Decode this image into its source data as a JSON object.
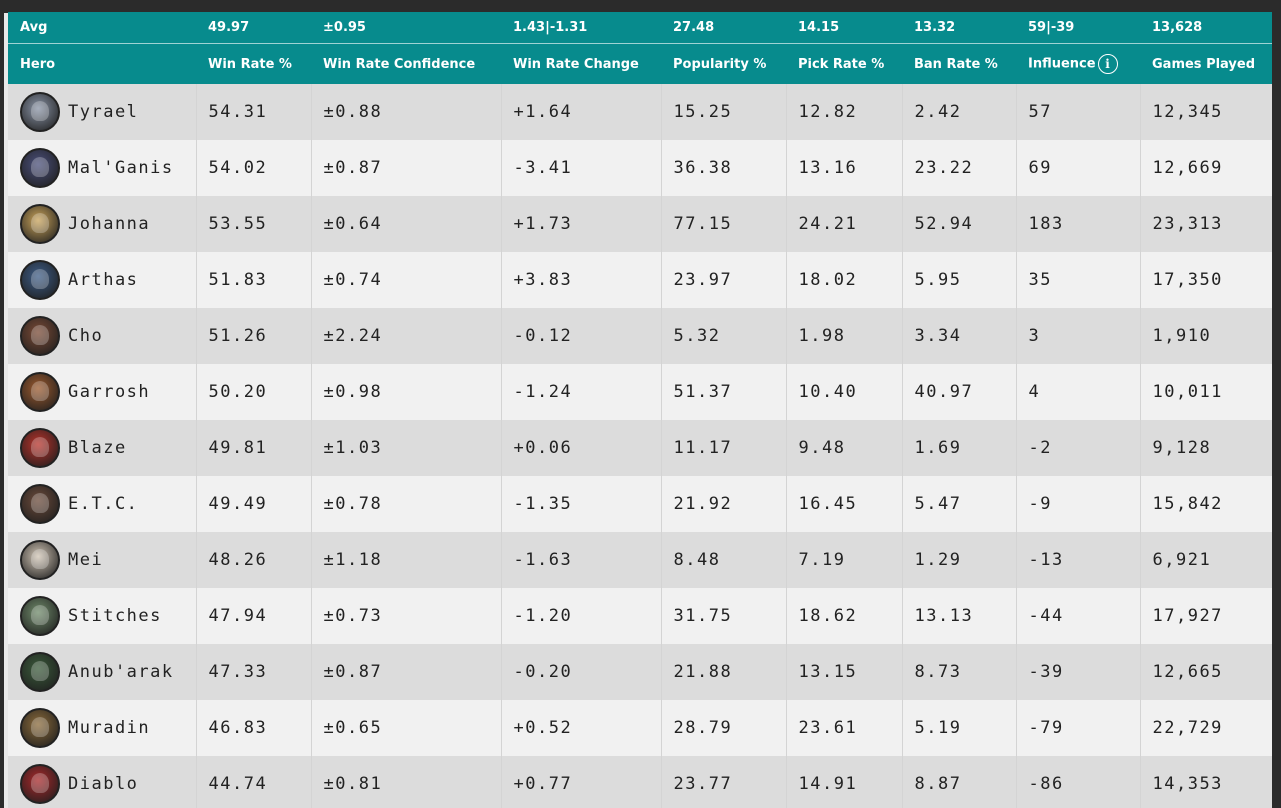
{
  "columns": [
    "Hero",
    "Win Rate %",
    "Win Rate Confidence",
    "Win Rate Change",
    "Popularity %",
    "Pick Rate %",
    "Ban Rate %",
    "Influence",
    "Games Played"
  ],
  "avg": [
    "Avg",
    "49.97",
    "±0.95",
    "1.43|-1.31",
    "27.48",
    "14.15",
    "13.32",
    "59|-39",
    "13,628"
  ],
  "info_icon": "i",
  "rows": [
    {
      "hero": "Tyrael",
      "avatar_color": "#8a94a6",
      "cells": [
        "54.31",
        "±0.88",
        "+1.64",
        "15.25",
        "12.82",
        "2.42",
        "57",
        "12,345"
      ]
    },
    {
      "hero": "Mal'Ganis",
      "avatar_color": "#4a4f7a",
      "cells": [
        "54.02",
        "±0.87",
        "-3.41",
        "36.38",
        "13.16",
        "23.22",
        "69",
        "12,669"
      ]
    },
    {
      "hero": "Johanna",
      "avatar_color": "#c9a35a",
      "cells": [
        "53.55",
        "±0.64",
        "+1.73",
        "77.15",
        "24.21",
        "52.94",
        "183",
        "23,313"
      ]
    },
    {
      "hero": "Arthas",
      "avatar_color": "#3d5c86",
      "cells": [
        "51.83",
        "±0.74",
        "+3.83",
        "23.97",
        "18.02",
        "5.95",
        "35",
        "17,350"
      ]
    },
    {
      "hero": "Cho",
      "avatar_color": "#7a4a35",
      "cells": [
        "51.26",
        "±2.24",
        "-0.12",
        "5.32",
        "1.98",
        "3.34",
        "3",
        "1,910"
      ]
    },
    {
      "hero": "Garrosh",
      "avatar_color": "#9c5a2e",
      "cells": [
        "50.20",
        "±0.98",
        "-1.24",
        "51.37",
        "10.40",
        "40.97",
        "4",
        "10,011"
      ]
    },
    {
      "hero": "Blaze",
      "avatar_color": "#b8322a",
      "cells": [
        "49.81",
        "±1.03",
        "+0.06",
        "11.17",
        "9.48",
        "1.69",
        "-2",
        "9,128"
      ]
    },
    {
      "hero": "E.T.C.",
      "avatar_color": "#6b4a3a",
      "cells": [
        "49.49",
        "±0.78",
        "-1.35",
        "21.92",
        "16.45",
        "5.47",
        "-9",
        "15,842"
      ]
    },
    {
      "hero": "Mei",
      "avatar_color": "#d0c4b4",
      "cells": [
        "48.26",
        "±1.18",
        "-1.63",
        "8.48",
        "7.19",
        "1.29",
        "-13",
        "6,921"
      ]
    },
    {
      "hero": "Stitches",
      "avatar_color": "#6f8a6a",
      "cells": [
        "47.94",
        "±0.73",
        "-1.20",
        "31.75",
        "18.62",
        "13.13",
        "-44",
        "17,927"
      ]
    },
    {
      "hero": "Anub'arak",
      "avatar_color": "#3a5a3a",
      "cells": [
        "47.33",
        "±0.87",
        "-0.20",
        "21.88",
        "13.15",
        "8.73",
        "-39",
        "12,665"
      ]
    },
    {
      "hero": "Muradin",
      "avatar_color": "#8a6a3a",
      "cells": [
        "46.83",
        "±0.65",
        "+0.52",
        "28.79",
        "23.61",
        "5.19",
        "-79",
        "22,729"
      ]
    },
    {
      "hero": "Diablo",
      "avatar_color": "#a8282a",
      "cells": [
        "44.74",
        "±0.81",
        "+0.77",
        "23.77",
        "14.91",
        "8.87",
        "-86",
        "14,353"
      ]
    }
  ]
}
